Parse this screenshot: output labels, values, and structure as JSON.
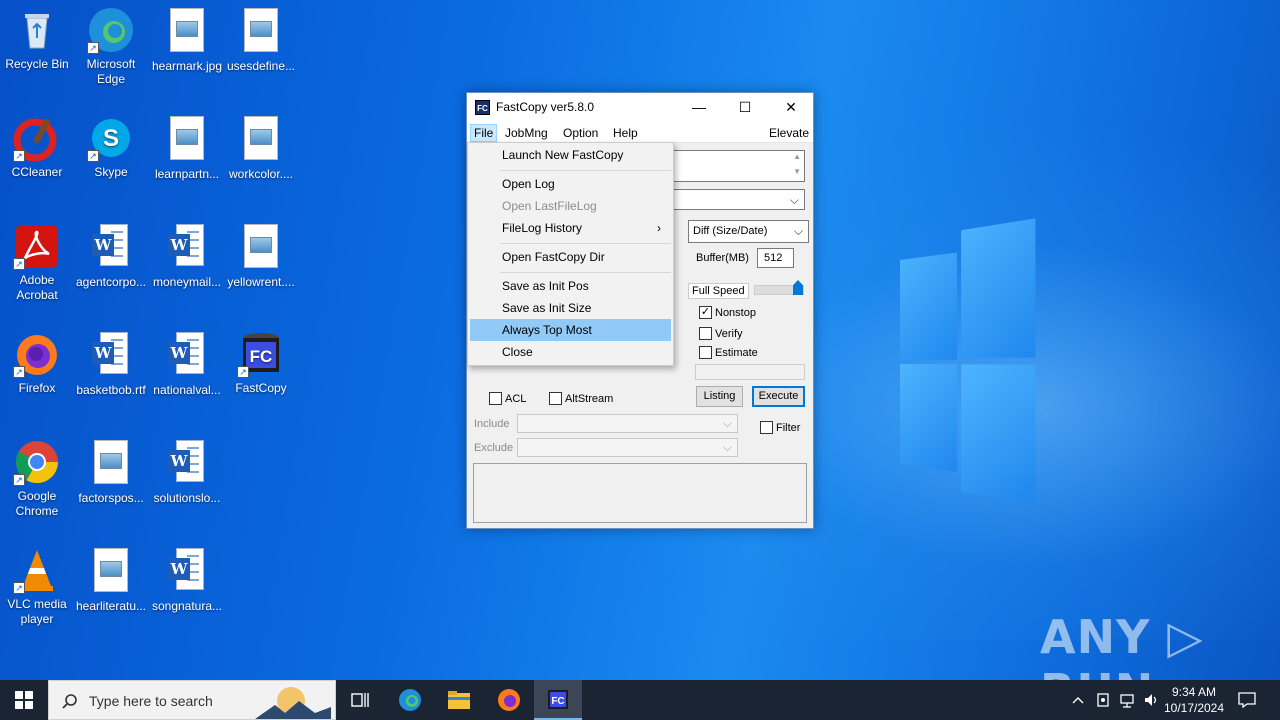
{
  "desktop": {
    "icons": [
      {
        "label": "Recycle Bin",
        "icon": "recycle-bin-icon"
      },
      {
        "label": "Microsoft Edge",
        "icon": "edge-icon"
      },
      {
        "label": "hearmark.jpg",
        "icon": "image-file-icon"
      },
      {
        "label": "usesdefine...",
        "icon": "image-file-icon"
      },
      {
        "label": "CCleaner",
        "icon": "ccleaner-icon"
      },
      {
        "label": "Skype",
        "icon": "skype-icon"
      },
      {
        "label": "learnpartn...",
        "icon": "image-file-icon"
      },
      {
        "label": "workcolor....",
        "icon": "image-file-icon"
      },
      {
        "label": "Adobe Acrobat",
        "icon": "acrobat-icon"
      },
      {
        "label": "agentcorpo...",
        "icon": "word-doc-icon"
      },
      {
        "label": "moneymail...",
        "icon": "word-doc-icon"
      },
      {
        "label": "yellowrent....",
        "icon": "image-file-icon"
      },
      {
        "label": "Firefox",
        "icon": "firefox-icon"
      },
      {
        "label": "basketbob.rtf",
        "icon": "word-doc-icon"
      },
      {
        "label": "nationalval...",
        "icon": "word-doc-icon"
      },
      {
        "label": "FastCopy",
        "icon": "fastcopy-icon"
      },
      {
        "label": "Google Chrome",
        "icon": "chrome-icon"
      },
      {
        "label": "factorspos...",
        "icon": "image-file-icon"
      },
      {
        "label": "solutionslo...",
        "icon": "word-doc-icon"
      },
      {
        "label": "VLC media player",
        "icon": "vlc-icon"
      },
      {
        "label": "hearliteratu...",
        "icon": "image-file-icon"
      },
      {
        "label": "songnatura...",
        "icon": "word-doc-icon"
      }
    ]
  },
  "window": {
    "title": "FastCopy ver5.8.0",
    "app_icon": "FC",
    "minimize": "—",
    "maximize": "☐",
    "close": "✕",
    "menu": {
      "file": "File",
      "jobmng": "JobMng",
      "option": "Option",
      "help": "Help",
      "elevate": "Elevate"
    },
    "mode_select": "Diff (Size/Date)",
    "buffer_label": "Buffer(MB)",
    "buffer_value": "512",
    "speed_label": "Full Speed",
    "nonstop_label": "Nonstop",
    "nonstop_checked": true,
    "verify_label": "Verify",
    "estimate_label": "Estimate",
    "listing_button": "Listing",
    "execute_button": "Execute",
    "acl_label": "ACL",
    "altstream_label": "AltStream",
    "include_label": "Include",
    "exclude_label": "Exclude",
    "filter_label": "Filter"
  },
  "file_menu": {
    "items": [
      {
        "label": "Launch New FastCopy",
        "disabled": false
      },
      {
        "label": "Open Log",
        "disabled": false
      },
      {
        "label": "Open LastFileLog",
        "disabled": true
      },
      {
        "label": "FileLog History",
        "disabled": false,
        "submenu": true
      },
      {
        "label": "Open FastCopy Dir",
        "disabled": false
      },
      {
        "label": "Save as Init Pos",
        "disabled": false
      },
      {
        "label": "Save as Init Size",
        "disabled": false
      },
      {
        "label": "Always Top Most",
        "disabled": false,
        "highlighted": true
      },
      {
        "label": "Close",
        "disabled": false
      }
    ],
    "submenu_arrow": "›"
  },
  "taskbar": {
    "search_placeholder": "Type here to search",
    "time": "9:34 AM",
    "date": "10/17/2024"
  },
  "watermark": "ANY ▷ RUN",
  "colors": {
    "desktop_blue": "#0a6be0",
    "taskbar": "#1a2433",
    "menu_highlight": "#91c9f7",
    "execute_border": "#0078d7"
  }
}
